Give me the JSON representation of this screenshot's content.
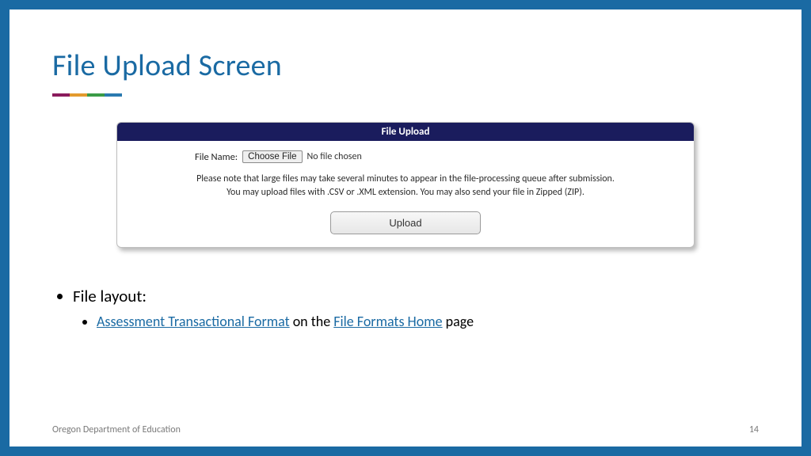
{
  "title": "File Upload Screen",
  "panel": {
    "header": "File Upload",
    "file_label": "File Name:",
    "choose_label": "Choose File",
    "no_file": "No file chosen",
    "note_line1": "Please note that large files may take several minutes to appear in the file-processing queue after submission.",
    "note_line2": "You may upload files with .CSV or .XML extension. You may also send your file in Zipped (ZIP).",
    "upload_label": "Upload"
  },
  "bullets": {
    "layout_label": "File layout:",
    "link1": "Assessment Transactional Format",
    "mid": " on the ",
    "link2": "File Formats Home",
    "tail": " page"
  },
  "footer": {
    "org": "Oregon Department of Education",
    "page": "14"
  }
}
